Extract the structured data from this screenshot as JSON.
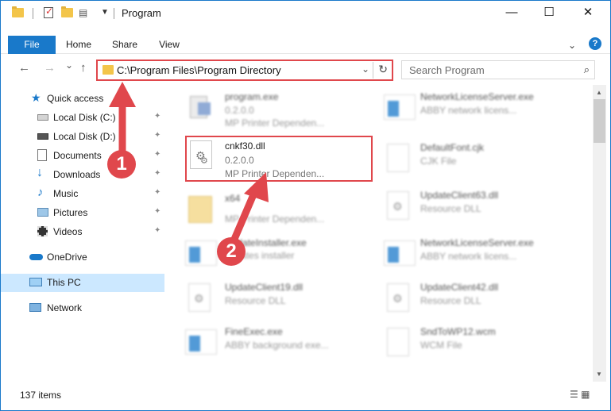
{
  "window": {
    "title": "Program",
    "minimize": "—",
    "maximize": "☐",
    "close": "✕"
  },
  "ribbon": {
    "tabs": [
      "File",
      "Home",
      "Share",
      "View"
    ],
    "help": "?"
  },
  "nav": {
    "back": "←",
    "forward": "→",
    "recent": "⌄",
    "up": "↑",
    "address": "C:\\Program Files\\Program Directory",
    "dropdown": "⌄",
    "refresh": "↻",
    "search_placeholder": "Search Program",
    "search_glyph": "⌕"
  },
  "sidebar": {
    "items": [
      {
        "label": "Quick access",
        "pinned": false
      },
      {
        "label": "Local Disk (C:)",
        "pinned": true
      },
      {
        "label": "Local Disk (D:)",
        "pinned": true
      },
      {
        "label": "Documents",
        "pinned": true
      },
      {
        "label": "Downloads",
        "pinned": true
      },
      {
        "label": "Music",
        "pinned": true
      },
      {
        "label": "Pictures",
        "pinned": true
      },
      {
        "label": "Videos",
        "pinned": true
      },
      {
        "label": "OneDrive",
        "pinned": false
      },
      {
        "label": "This PC",
        "pinned": false,
        "selected": true
      },
      {
        "label": "Network",
        "pinned": false
      }
    ],
    "pin_glyph": "📌"
  },
  "files": {
    "left": [
      {
        "name": "program.exe",
        "line2": "0.2.0.0",
        "line3": "MP Printer Dependen..."
      },
      {
        "name": "cnkf30.dll",
        "line2": "0.2.0.0",
        "line3": "MP Printer Dependen...",
        "focused": true
      },
      {
        "name": "x64",
        "line2": "",
        "line3": "MP Printer Dependen..."
      },
      {
        "name": "UpdateInstaller.exe",
        "line2": "",
        "line3": "updates installer"
      },
      {
        "name": "UpdateClient19.dll",
        "line2": "Resource DLL",
        "line3": ""
      },
      {
        "name": "FineExec.exe",
        "line2": "ABBY background exe...",
        "line3": ""
      }
    ],
    "right": [
      {
        "name": "NetworkLicenseServer.exe",
        "line2": "ABBY network licens...",
        "line3": ""
      },
      {
        "name": "DefaultFont.cjk",
        "line2": "CJK File",
        "line3": ""
      },
      {
        "name": "UpdateClient63.dll",
        "line2": "Resource DLL",
        "line3": ""
      },
      {
        "name": "NetworkLicenseServer.exe",
        "line2": "ABBY network licens...",
        "line3": ""
      },
      {
        "name": "UpdateClient42.dll",
        "line2": "Resource DLL",
        "line3": ""
      },
      {
        "name": "SndToWP12.wcm",
        "line2": "WCM File",
        "line3": ""
      }
    ]
  },
  "status": {
    "count": "137 items",
    "view_glyphs": "☰ ▦"
  },
  "annotations": {
    "step1": "1",
    "step2": "2"
  },
  "colors": {
    "accent": "#1979ca",
    "highlight": "#e0474c",
    "selection": "#cce8ff"
  }
}
